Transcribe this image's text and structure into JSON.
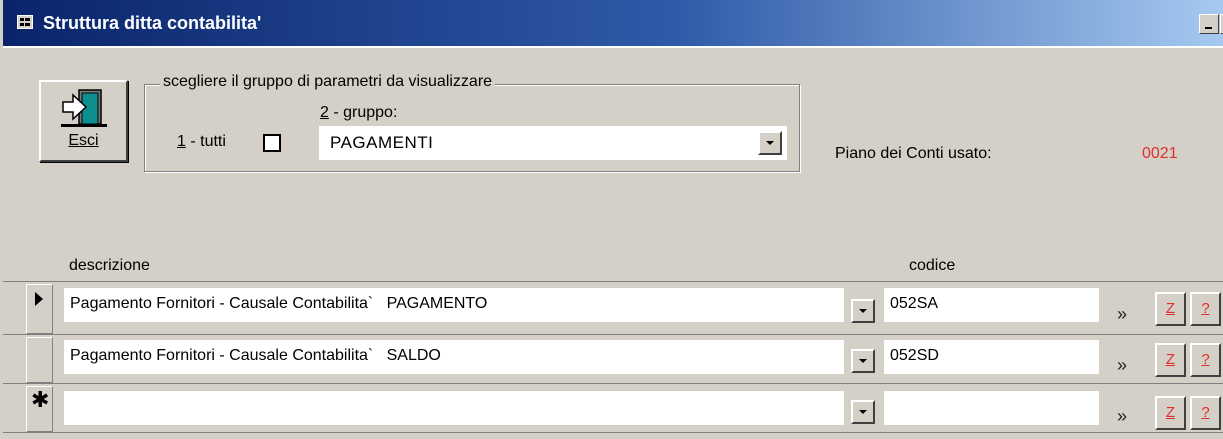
{
  "window": {
    "title": "Struttura ditta contabilita'"
  },
  "toolbar": {
    "exit_label": "Esci"
  },
  "filter": {
    "legend": "scegliere il gruppo di parametri da visualizzare",
    "group_label_num": "2",
    "group_label_rest": " - gruppo:",
    "all_label_num": "1",
    "all_label_rest": " - tutti",
    "all_checked": false,
    "group_value": "PAGAMENTI"
  },
  "chart_of_accounts": {
    "label": "Piano dei Conti usato:",
    "value": "0021",
    "value_color": "#e0302c"
  },
  "grid": {
    "columns": {
      "description": "descrizione",
      "code": "codice"
    },
    "rows": [
      {
        "description": "Pagamento Fornitori - Causale Contabilita`   PAGAMENTO",
        "code": "052SA",
        "current": true
      },
      {
        "description": "Pagamento Fornitori - Causale Contabilita`   SALDO",
        "code": "052SD",
        "current": false
      },
      {
        "description": "",
        "code": "",
        "new_record": true
      }
    ],
    "row_buttons": {
      "more": "»",
      "z": "Z",
      "help": "?"
    }
  }
}
